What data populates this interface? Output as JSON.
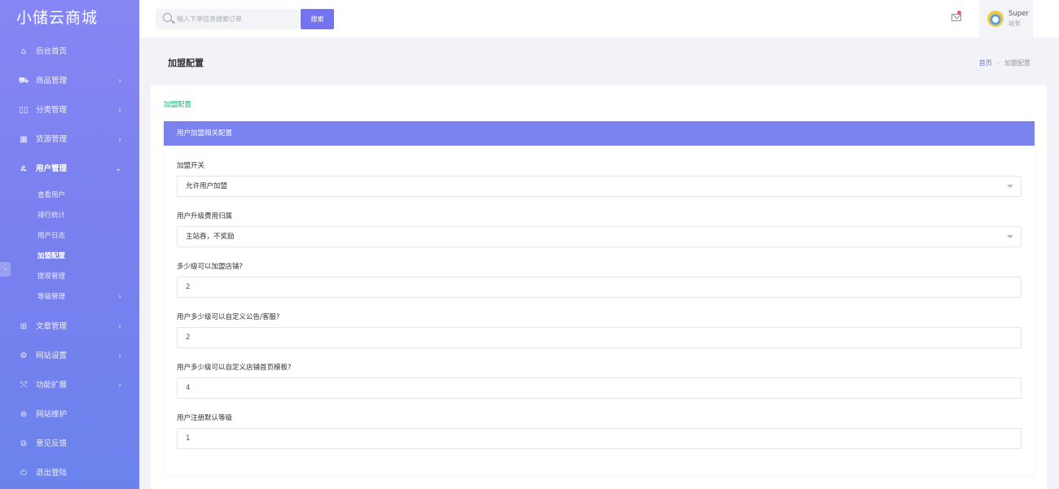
{
  "brand": "小储云商城",
  "sidebar": {
    "items": [
      {
        "icon": "⌂",
        "label": "后台首页",
        "arrow": ""
      },
      {
        "icon": "⛟",
        "label": "商品管理",
        "arrow": "›"
      },
      {
        "icon": "▯▯",
        "label": "分类管理",
        "arrow": "›"
      },
      {
        "icon": "▦",
        "label": "货源管理",
        "arrow": "›"
      },
      {
        "icon": "ዴ",
        "label": "用户管理",
        "arrow": "⌄"
      },
      {
        "icon": "⊞",
        "label": "文章管理",
        "arrow": "›"
      },
      {
        "icon": "⚙",
        "label": "网站设置",
        "arrow": "›"
      },
      {
        "icon": "⤲",
        "label": "功能扩展",
        "arrow": "›"
      },
      {
        "icon": "⊛",
        "label": "网站维护",
        "arrow": ""
      },
      {
        "icon": "⧉",
        "label": "意见反馈",
        "arrow": ""
      },
      {
        "icon": "⏻",
        "label": "退出登陆",
        "arrow": ""
      }
    ],
    "sub_items": [
      {
        "label": "查看用户",
        "arrow": ""
      },
      {
        "label": "排行统计",
        "arrow": ""
      },
      {
        "label": "用户日志",
        "arrow": ""
      },
      {
        "label": "加盟配置",
        "arrow": ""
      },
      {
        "label": "提现管理",
        "arrow": ""
      },
      {
        "label": "等级管理",
        "arrow": "›"
      }
    ]
  },
  "search": {
    "placeholder": "输入下单信息搜索订单",
    "button": "搜索"
  },
  "user": {
    "name": "Super",
    "role": "站长"
  },
  "page": {
    "title": "加盟配置"
  },
  "breadcrumb": {
    "home": "首页",
    "separator": "›",
    "current": "加盟配置"
  },
  "card": {
    "label": "加盟配置"
  },
  "panel": {
    "title": "用户加盟相关配置",
    "fields": [
      {
        "label": "加盟开关",
        "value": "允许用户加盟",
        "type": "select"
      },
      {
        "label": "用户升级费用归属",
        "value": "主站吞，不奖励",
        "type": "select"
      },
      {
        "label": "多少级可以加盟店铺?",
        "value": "2",
        "type": "input"
      },
      {
        "label": "用户多少级可以自定义公告/客服?",
        "value": "2",
        "type": "input"
      },
      {
        "label": "用户多少级可以自定义店铺首页模板?",
        "value": "4",
        "type": "input"
      },
      {
        "label": "用户注册默认等级",
        "value": "1",
        "type": "input"
      }
    ]
  },
  "colors": {
    "sidebar_top": "#8686f4",
    "sidebar_bottom": "#6b82ec",
    "accent": "#7473f2",
    "panel_header": "#7a82ef",
    "success_text": "#19b47b",
    "notification_dot": "#f05a6a"
  }
}
